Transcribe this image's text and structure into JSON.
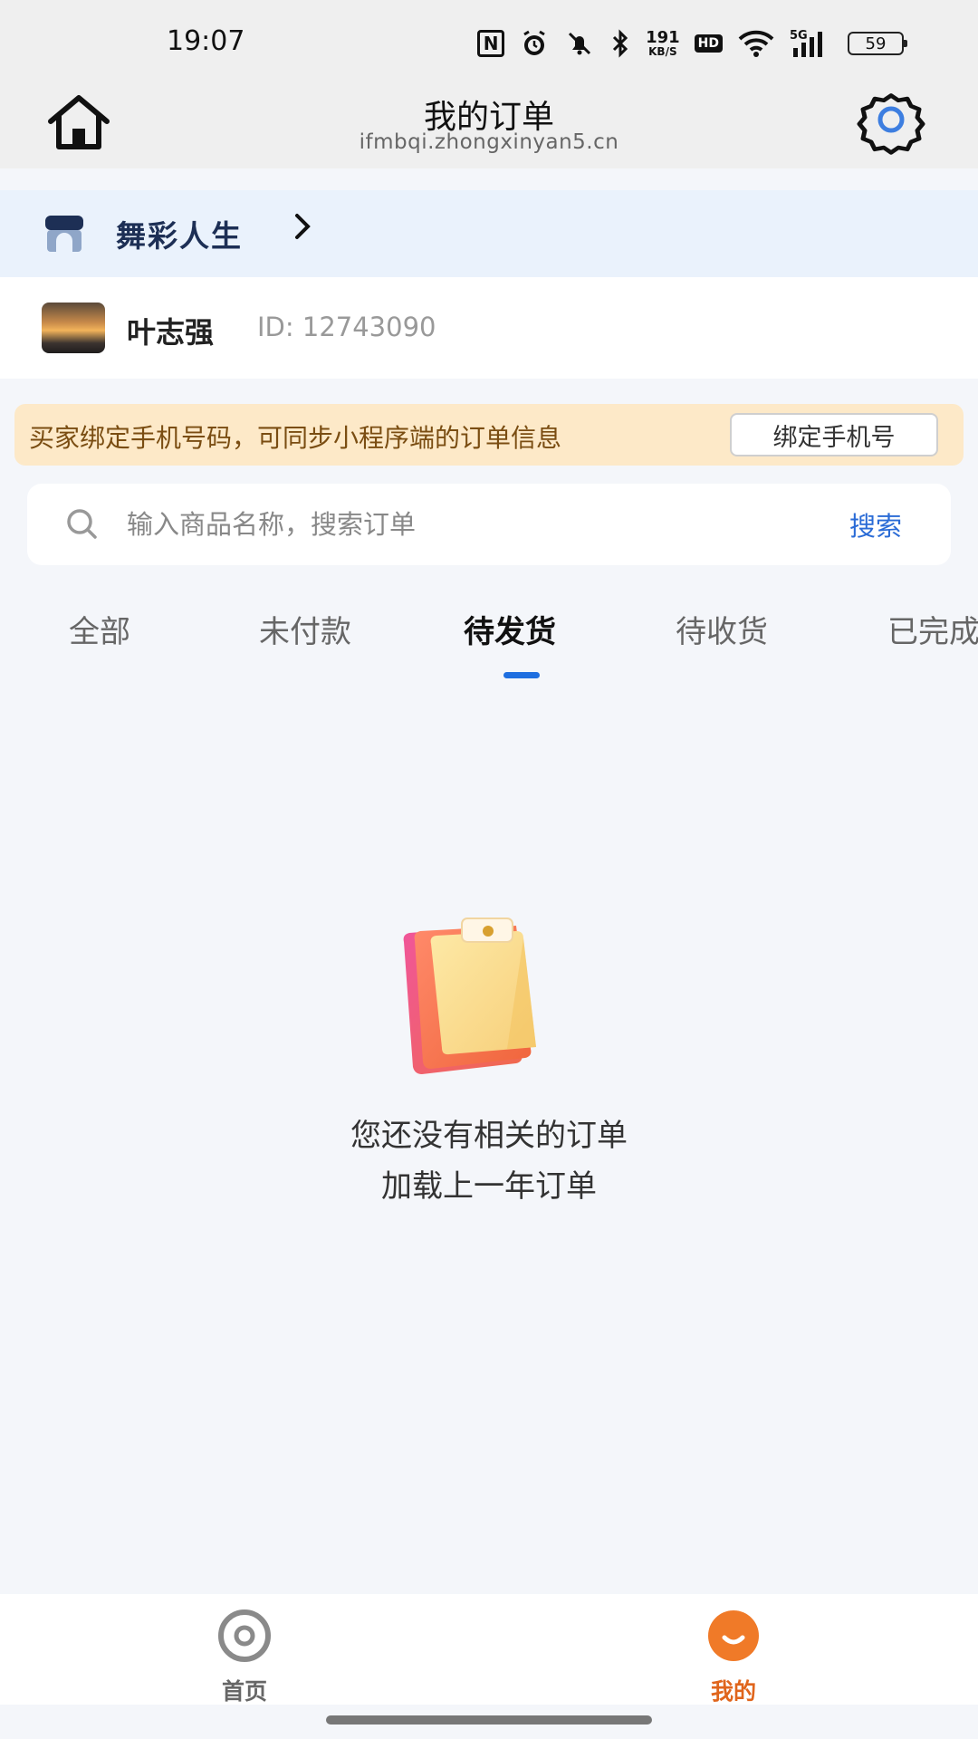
{
  "status_bar": {
    "time": "19:07",
    "net_rate": "191",
    "net_unit": "KB/S",
    "hd": "HD",
    "signal": "5G",
    "battery": "59",
    "icons": [
      "nfc-icon",
      "alarm-icon",
      "mute-icon",
      "bluetooth-icon",
      "wifi-icon",
      "cell-signal-icon",
      "battery-icon"
    ]
  },
  "header": {
    "title": "我的订单",
    "url": "ifmbqi.zhongxinyan5.cn",
    "left_icon": "home-icon",
    "right_icon": "gear-icon"
  },
  "shop": {
    "name": "舞彩人生",
    "chevron": "›"
  },
  "user": {
    "name": "叶志强",
    "id_text": "ID: 12743090"
  },
  "notice": {
    "text": "买家绑定手机号码，可同步小程序端的订单信息",
    "button": "绑定手机号"
  },
  "search": {
    "placeholder": "输入商品名称，搜索订单",
    "value": "",
    "button": "搜索"
  },
  "tabs": [
    {
      "label": "全部",
      "active": false
    },
    {
      "label": "未付款",
      "active": false
    },
    {
      "label": "待发货",
      "active": true
    },
    {
      "label": "待收货",
      "active": false
    },
    {
      "label": "已完成",
      "active": false
    }
  ],
  "empty": {
    "line1": "您还没有相关的订单",
    "line2": "加载上一年订单"
  },
  "bottom_nav": [
    {
      "label": "首页",
      "icon": "home-target-icon",
      "active": false
    },
    {
      "label": "我的",
      "icon": "smile-icon",
      "active": true
    }
  ],
  "colors": {
    "accent_blue": "#1f6fe0",
    "active_orange": "#e0651c",
    "notice_bg": "#fde9c8",
    "shop_bg": "#eaf2fc"
  }
}
